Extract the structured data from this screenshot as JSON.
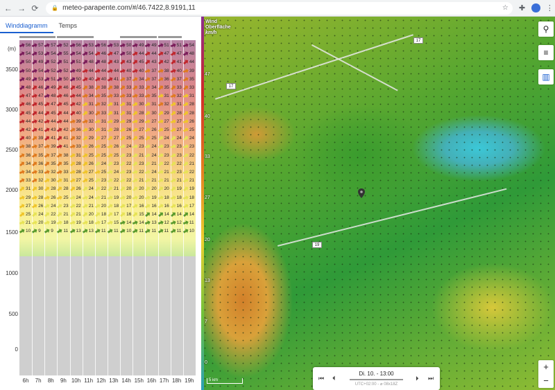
{
  "browser": {
    "url": "meteo-parapente.com/#/46.7422,8.9191,11",
    "back": "←",
    "forward": "→",
    "reload": "⟳",
    "star": "☆",
    "ext": "✚",
    "menu": "⋮"
  },
  "tabs": [
    {
      "label": "Winddiagramm",
      "active": true
    },
    {
      "label": "Temps",
      "active": false
    }
  ],
  "diagram": {
    "unit": "(m)",
    "y_ticks": [
      "3500",
      "3000",
      "2500",
      "2000",
      "1500",
      "1000",
      "500",
      "0"
    ],
    "hours": [
      "6h",
      "7h",
      "8h",
      "9h",
      "10h",
      "11h",
      "12h",
      "13h",
      "14h",
      "15h",
      "16h",
      "17h",
      "18h",
      "19h"
    ],
    "colors": {
      "purple": "#7a1c5a",
      "red": "#c0262c",
      "orange": "#e07a1e",
      "yellow": "#f0c52a",
      "lightyellow": "#e7e356",
      "green": "#5a9a2e"
    },
    "rows": [
      [
        "56",
        "57",
        "57",
        "52",
        "56",
        "53",
        "56",
        "53",
        "50",
        "49",
        "49",
        "51",
        "51",
        "54"
      ],
      [
        "54",
        "53",
        "54",
        "55",
        "54",
        "54",
        "46",
        "47",
        "50",
        "44",
        "44",
        "47",
        "47",
        "48"
      ],
      [
        "50",
        "49",
        "52",
        "51",
        "51",
        "48",
        "48",
        "43",
        "43",
        "45",
        "43",
        "42",
        "41",
        "44"
      ],
      [
        "50",
        "54",
        "52",
        "52",
        "49",
        "44",
        "44",
        "44",
        "40",
        "40",
        "37",
        "38",
        "40",
        "39"
      ],
      [
        "49",
        "53",
        "51",
        "50",
        "50",
        "40",
        "40",
        "41",
        "37",
        "34",
        "37",
        "36",
        "37",
        "35"
      ],
      [
        "48",
        "46",
        "49",
        "46",
        "45",
        "38",
        "38",
        "38",
        "33",
        "33",
        "34",
        "35",
        "33",
        "33"
      ],
      [
        "47",
        "47",
        "48",
        "46",
        "44",
        "34",
        "35",
        "33",
        "33",
        "33",
        "35",
        "31",
        "32",
        "31"
      ],
      [
        "46",
        "45",
        "47",
        "45",
        "42",
        "31",
        "32",
        "31",
        "31",
        "30",
        "31",
        "32",
        "31",
        "28"
      ],
      [
        "45",
        "44",
        "45",
        "44",
        "40",
        "30",
        "33",
        "31",
        "31",
        "28",
        "30",
        "29",
        "28",
        "28"
      ],
      [
        "44",
        "42",
        "44",
        "44",
        "39",
        "32",
        "31",
        "29",
        "29",
        "29",
        "27",
        "27",
        "27",
        "26"
      ],
      [
        "42",
        "41",
        "43",
        "42",
        "36",
        "30",
        "31",
        "28",
        "26",
        "27",
        "26",
        "25",
        "27",
        "25"
      ],
      [
        "40",
        "39",
        "41",
        "41",
        "32",
        "29",
        "27",
        "27",
        "25",
        "25",
        "25",
        "24",
        "24",
        "24"
      ],
      [
        "38",
        "37",
        "39",
        "41",
        "33",
        "26",
        "25",
        "26",
        "24",
        "23",
        "24",
        "23",
        "23",
        "23"
      ],
      [
        "36",
        "35",
        "37",
        "38",
        "31",
        "25",
        "25",
        "25",
        "23",
        "21",
        "24",
        "23",
        "23",
        "22"
      ],
      [
        "34",
        "36",
        "35",
        "35",
        "28",
        "26",
        "24",
        "23",
        "22",
        "23",
        "21",
        "22",
        "22",
        "21"
      ],
      [
        "34",
        "33",
        "32",
        "33",
        "28",
        "27",
        "25",
        "24",
        "23",
        "22",
        "24",
        "21",
        "23",
        "22"
      ],
      [
        "33",
        "32",
        "30",
        "31",
        "27",
        "25",
        "23",
        "22",
        "22",
        "21",
        "21",
        "21",
        "21",
        "21"
      ],
      [
        "31",
        "30",
        "28",
        "28",
        "26",
        "24",
        "22",
        "21",
        "20",
        "20",
        "20",
        "20",
        "19",
        "19"
      ],
      [
        "29",
        "28",
        "26",
        "25",
        "24",
        "24",
        "21",
        "19",
        "20",
        "20",
        "19",
        "18",
        "18",
        "18"
      ],
      [
        "27",
        "26",
        "24",
        "23",
        "22",
        "21",
        "20",
        "18",
        "17",
        "16",
        "16",
        "16",
        "16",
        "17"
      ],
      [
        "25",
        "24",
        "22",
        "21",
        "21",
        "20",
        "18",
        "17",
        "16",
        "15",
        "14",
        "14",
        "14",
        "14"
      ],
      [
        "21",
        "20",
        "19",
        "18",
        "19",
        "18",
        "17",
        "15",
        "14",
        "14",
        "13",
        "12",
        "12",
        "11"
      ],
      [
        "10",
        "9",
        "9",
        "11",
        "13",
        "13",
        "11",
        "11",
        "10",
        "11",
        "11",
        "11",
        "11",
        "10"
      ]
    ]
  },
  "map": {
    "legend_title_1": "Wind",
    "legend_title_2": "Oberfläche",
    "legend_unit": "km/h",
    "colorbar_labels": [
      "47",
      "40",
      "33",
      "27",
      "20",
      "13",
      "7",
      "0"
    ],
    "roads": [
      "17",
      "17",
      "19"
    ],
    "scale": "5 km",
    "time": {
      "label": "Di. 10. - 13:00",
      "sub": "UTC+02:00 - ⌀ 08x18Z"
    },
    "buttons": {
      "search": "⚲",
      "settings": "≡",
      "chart": "▥",
      "zoom_in": "+",
      "zoom_out": "−"
    }
  }
}
